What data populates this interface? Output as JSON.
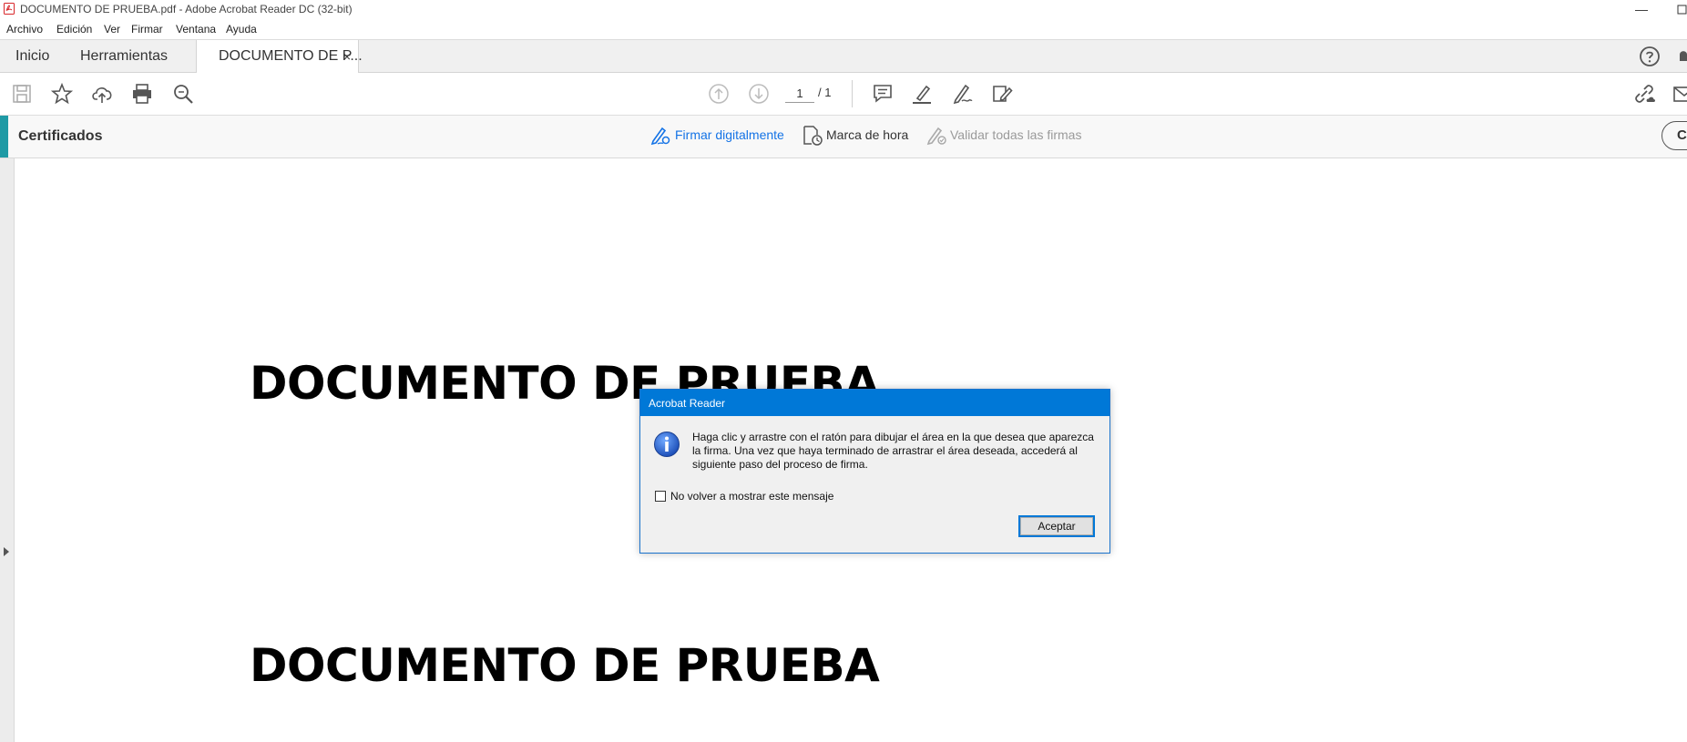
{
  "window": {
    "title": "DOCUMENTO DE PRUEBA.pdf - Adobe Acrobat Reader DC (32-bit)",
    "app_icon": "acrobat-pdf-icon",
    "minimize_symbol": "—"
  },
  "menu": {
    "items": [
      "Archivo",
      "Edición",
      "Ver",
      "Firmar",
      "Ventana",
      "Ayuda"
    ]
  },
  "tabs": {
    "home": "Inicio",
    "tools": "Herramientas",
    "document": "DOCUMENTO DE P...",
    "close_symbol": "×"
  },
  "toolbar": {
    "icons": [
      "save-icon",
      "bookmark-star-icon",
      "cloud-upload-icon",
      "print-icon",
      "zoom-search-icon",
      "page-up-icon",
      "page-down-icon",
      "comment-icon",
      "highlight-icon",
      "sign-pen-icon",
      "fill-sign-icon",
      "share-link-icon",
      "email-icon"
    ],
    "current_page": "1",
    "total_pages": "/ 1",
    "help_icon": "help-icon",
    "bell_icon": "bell-icon"
  },
  "certificates": {
    "title": "Certificados",
    "sign_digitally": "Firmar digitalmente",
    "timestamp": "Marca de hora",
    "validate_all": "Validar todas las firmas",
    "close_label": "C",
    "accent_color": "#1f9aa5",
    "link_color": "#1473e6",
    "disabled_color": "#9a9a9a"
  },
  "document": {
    "heading_1": "DOCUMENTO DE PRUEBA",
    "heading_2": "DOCUMENTO DE PRUEBA"
  },
  "dialog": {
    "title": "Acrobat Reader",
    "message": "Haga clic y arrastre con el ratón para dibujar el área en la que desea que aparezca la firma. Una vez que haya terminado de arrastrar el área deseada, accederá al siguiente paso del proceso de firma.",
    "checkbox_label": "No volver a mostrar este mensaje",
    "checkbox_checked": false,
    "ok_label": "Aceptar",
    "titlebar_color": "#0078d7",
    "icon": "info-icon"
  }
}
